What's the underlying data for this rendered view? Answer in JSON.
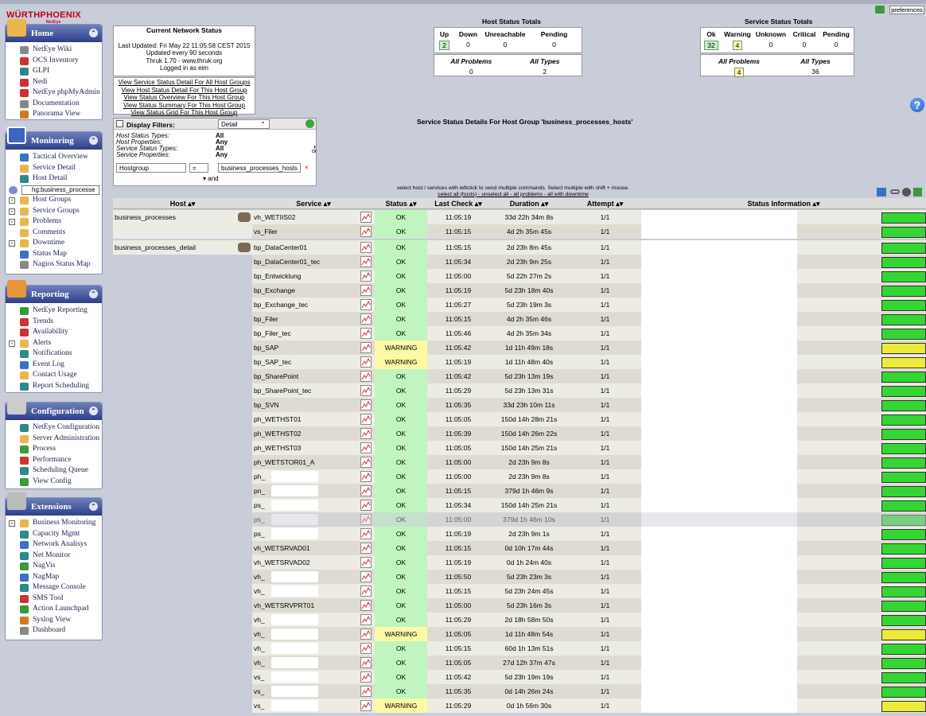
{
  "logo": {
    "text": "WÜRTHPHOENIX",
    "sub": "NetEye"
  },
  "preferences": "preferences",
  "sidebar": {
    "home": {
      "title": "Home",
      "items": [
        "NetEye Wiki",
        "OCS Inventory",
        "GLPI",
        "Nedi",
        "NetEye phpMyAdmin",
        "Documentation",
        "Panorama View"
      ]
    },
    "monitoring": {
      "title": "Monitoring",
      "items": [
        "Tactical Overview",
        "Service Detail",
        "Host Detail"
      ],
      "search_value": "hg:business_processe",
      "folders": [
        "Host Groups",
        "Service Groups",
        "Problems"
      ],
      "items2": [
        "Comments"
      ],
      "folders2": [
        "Downtime"
      ],
      "items3": [
        "Status Map",
        "Nagios Status Map"
      ]
    },
    "reporting": {
      "title": "Reporting",
      "items": [
        "NetEye Reporting",
        "Trends",
        "Availability"
      ],
      "folders": [
        "Alerts"
      ],
      "items2": [
        "Notifications",
        "Event Log",
        "Contact Usage",
        "Report Scheduling"
      ]
    },
    "configuration": {
      "title": "Configuration",
      "items": [
        "NetEye Configuration",
        "Server Administration",
        "Process",
        "Performance",
        "Scheduling Queue",
        "View Config"
      ]
    },
    "extensions": {
      "title": "Extensions",
      "folders": [
        "Business Monitoring"
      ],
      "items": [
        "Capacity Mgmt",
        "Network Analisys",
        "Net Monitor",
        "NagVis",
        "NagMap",
        "Message Console",
        "SMS Tool",
        "Action Launchpad",
        "Syslog View",
        "Dashboard"
      ]
    }
  },
  "network_status": {
    "title": "Current Network Status",
    "lines": [
      "Last Updated: Fri May 22 11:05:58 CEST 2015",
      "Updated every 90 seconds",
      "Thruk 1.70 - www.thruk.org",
      "Logged in as eim"
    ]
  },
  "links": [
    "View Service Status Detail For All Host Groups",
    "View Host Status Detail For This Host Group",
    "View Status Overview For This Host Group",
    "View Status Summary For This Host Group",
    "View Status Grid For This Host Group"
  ],
  "filters": {
    "title": "Display Filters:",
    "mode": "Detail",
    "rows": [
      [
        "Host Status Types:",
        "All"
      ],
      [
        "Host Properties:",
        "Any"
      ],
      [
        "Service Status Types:",
        "All"
      ],
      [
        "Service Properties:",
        "Any"
      ]
    ],
    "field": "Hostgroup",
    "op": "=",
    "value": "business_processes_hosts",
    "and": "and",
    "or": "or"
  },
  "host_totals": {
    "title": "Host Status Totals",
    "headers": [
      "Up",
      "Down",
      "Unreachable",
      "Pending"
    ],
    "values": [
      "2",
      "0",
      "0",
      "0"
    ],
    "headers2": [
      "All Problems",
      "All Types"
    ],
    "values2": [
      "0",
      "2"
    ]
  },
  "service_totals": {
    "title": "Service Status Totals",
    "headers": [
      "Ok",
      "Warning",
      "Unknown",
      "Critical",
      "Pending"
    ],
    "values": [
      "32",
      "4",
      "0",
      "0",
      "0"
    ],
    "headers2": [
      "All Problems",
      "All Types"
    ],
    "values2": [
      "4",
      "36"
    ]
  },
  "page_title": "Service Status Details For Host Group 'business_processes_hosts'",
  "hint": [
    "select host / services with leftclick to send multiple commands. Select multiple with shift + mouse.",
    "select all (hosts) - unselect all - all problems - all with downtime"
  ],
  "columns": {
    "host": "Host",
    "service": "Service",
    "status": "Status",
    "last_check": "Last Check",
    "duration": "Duration",
    "attempt": "Attempt",
    "info": "Status Information"
  },
  "colors": {
    "ok": "#c0f5c0",
    "warning": "#fdfaa6",
    "bar_ok": "#33d633",
    "bar_warn": "#eeea3a"
  },
  "rows": [
    {
      "host": "business_processes",
      "svc": "vh_WETIIS02",
      "status": "OK",
      "lc": "11:05:19",
      "du": "33d 22h 34m 8s",
      "at": "1/1",
      "redact": false
    },
    {
      "host": "",
      "svc": "vs_Filer",
      "status": "OK",
      "lc": "11:05:15",
      "du": "4d 2h 35m 45s",
      "at": "1/1",
      "redact": false
    },
    {
      "host": "business_processes_detail",
      "svc": "bp_DataCenter01",
      "status": "OK",
      "lc": "11:05:15",
      "du": "2d 23h 8m 45s",
      "at": "1/1",
      "redact": false
    },
    {
      "host": "",
      "svc": "bp_DataCenter01_tec",
      "status": "OK",
      "lc": "11:05:34",
      "du": "2d 23h 9m 25s",
      "at": "1/1",
      "redact": false
    },
    {
      "host": "",
      "svc": "bp_Entwicklung",
      "status": "OK",
      "lc": "11:05:00",
      "du": "5d 22h 27m 2s",
      "at": "1/1",
      "redact": false
    },
    {
      "host": "",
      "svc": "bp_Exchange",
      "status": "OK",
      "lc": "11:05:19",
      "du": "5d 23h 18m 40s",
      "at": "1/1",
      "redact": false
    },
    {
      "host": "",
      "svc": "bp_Exchange_tec",
      "status": "OK",
      "lc": "11:05:27",
      "du": "5d 23h 19m 3s",
      "at": "1/1",
      "redact": false
    },
    {
      "host": "",
      "svc": "bp_Filer",
      "status": "OK",
      "lc": "11:05:15",
      "du": "4d 2h 35m 46s",
      "at": "1/1",
      "redact": false
    },
    {
      "host": "",
      "svc": "bp_Filer_tec",
      "status": "OK",
      "lc": "11:05:46",
      "du": "4d 2h 35m 34s",
      "at": "1/1",
      "redact": false
    },
    {
      "host": "",
      "svc": "bp_SAP",
      "status": "WARNING",
      "lc": "11:05:42",
      "du": "1d 11h 49m 18s",
      "at": "1/1",
      "redact": false
    },
    {
      "host": "",
      "svc": "bp_SAP_tec",
      "status": "WARNING",
      "lc": "11:05:19",
      "du": "1d 11h 48m 40s",
      "at": "1/1",
      "redact": false
    },
    {
      "host": "",
      "svc": "bp_SharePoint",
      "status": "OK",
      "lc": "11:05:42",
      "du": "5d 23h 13m 19s",
      "at": "1/1",
      "redact": false
    },
    {
      "host": "",
      "svc": "bp_SharePoint_tec",
      "status": "OK",
      "lc": "11:05:29",
      "du": "5d 23h 13m 31s",
      "at": "1/1",
      "redact": false
    },
    {
      "host": "",
      "svc": "bp_SVN",
      "status": "OK",
      "lc": "11:05:35",
      "du": "33d 23h 10m 11s",
      "at": "1/1",
      "redact": false
    },
    {
      "host": "",
      "svc": "ph_WETHST01",
      "status": "OK",
      "lc": "11:05:05",
      "du": "150d 14h 28m 21s",
      "at": "1/1",
      "redact": false
    },
    {
      "host": "",
      "svc": "ph_WETHST02",
      "status": "OK",
      "lc": "11:05:39",
      "du": "150d 14h 26m 22s",
      "at": "1/1",
      "redact": false
    },
    {
      "host": "",
      "svc": "ph_WETHST03",
      "status": "OK",
      "lc": "11:05:05",
      "du": "150d 14h 25m 21s",
      "at": "1/1",
      "redact": false
    },
    {
      "host": "",
      "svc": "ph_WETSTOR01_A",
      "status": "OK",
      "lc": "11:05:00",
      "du": "2d 23h 9m 8s",
      "at": "1/1",
      "redact": false
    },
    {
      "host": "",
      "svc": "ph_",
      "status": "OK",
      "lc": "11:05:00",
      "du": "2d 23h 9m 8s",
      "at": "1/1",
      "redact": true
    },
    {
      "host": "",
      "svc": "pn_",
      "status": "OK",
      "lc": "11:05:15",
      "du": "379d 1h 46m 9s",
      "at": "1/1",
      "redact": true
    },
    {
      "host": "",
      "svc": "ps_",
      "status": "OK",
      "lc": "11:05:34",
      "du": "150d 14h 25m 21s",
      "at": "1/1",
      "redact": true
    },
    {
      "host": "",
      "svc": "ps_",
      "status": "OK",
      "lc": "11:05:00",
      "du": "379d 1h 46m 10s",
      "at": "1/1",
      "redact": true,
      "faded": true
    },
    {
      "host": "",
      "svc": "ps_",
      "status": "OK",
      "lc": "11:05:19",
      "du": "2d 23h 9m 1s",
      "at": "1/1",
      "redact": true
    },
    {
      "host": "",
      "svc": "vh_WETSRVAD01",
      "status": "OK",
      "lc": "11:05:15",
      "du": "0d 10h 17m 44s",
      "at": "1/1",
      "redact": false
    },
    {
      "host": "",
      "svc": "vh_WETSRVAD02",
      "status": "OK",
      "lc": "11:05:19",
      "du": "0d 1h 24m 40s",
      "at": "1/1",
      "redact": false
    },
    {
      "host": "",
      "svc": "vh_",
      "status": "OK",
      "lc": "11:05:50",
      "du": "5d 23h 23m 3s",
      "at": "1/1",
      "redact": true
    },
    {
      "host": "",
      "svc": "vh_",
      "status": "OK",
      "lc": "11:05:15",
      "du": "5d 23h 24m 45s",
      "at": "1/1",
      "redact": true
    },
    {
      "host": "",
      "svc": "vh_WETSRVPRT01",
      "status": "OK",
      "lc": "11:05:00",
      "du": "5d 23h 16m 3s",
      "at": "1/1",
      "redact": false
    },
    {
      "host": "",
      "svc": "vh_",
      "status": "OK",
      "lc": "11:05:29",
      "du": "2d 18h 58m 50s",
      "at": "1/1",
      "redact": true
    },
    {
      "host": "",
      "svc": "vh_",
      "status": "WARNING",
      "lc": "11:05:05",
      "du": "1d 11h 48m 54s",
      "at": "1/1",
      "redact": true
    },
    {
      "host": "",
      "svc": "vh_",
      "status": "OK",
      "lc": "11:05:15",
      "du": "60d 1h 13m 51s",
      "at": "1/1",
      "redact": true
    },
    {
      "host": "",
      "svc": "vh_",
      "status": "OK",
      "lc": "11:05:05",
      "du": "27d 12h 37m 47s",
      "at": "1/1",
      "redact": true
    },
    {
      "host": "",
      "svc": "vs_",
      "status": "OK",
      "lc": "11:05:42",
      "du": "5d 23h 19m 19s",
      "at": "1/1",
      "redact": true
    },
    {
      "host": "",
      "svc": "vs_",
      "status": "OK",
      "lc": "11:05:35",
      "du": "0d 14h 26m 24s",
      "at": "1/1",
      "redact": true
    },
    {
      "host": "",
      "svc": "vs_",
      "status": "WARNING",
      "lc": "11:05:29",
      "du": "0d 1h 56m 30s",
      "at": "1/1",
      "redact": true
    }
  ]
}
